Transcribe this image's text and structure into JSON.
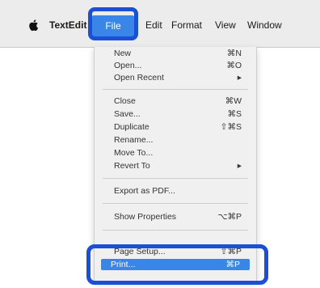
{
  "menubar": {
    "apple_icon": "apple-logo-icon",
    "app_name": "TextEdit",
    "items": [
      "File",
      "Edit",
      "Format",
      "View",
      "Window"
    ]
  },
  "file_menu": {
    "items": [
      {
        "label": "New",
        "shortcut": "⌘N"
      },
      {
        "label": "Open...",
        "shortcut": "⌘O"
      },
      {
        "label": "Open Recent",
        "shortcut": "▸"
      },
      {
        "label": "Close",
        "shortcut": "⌘W"
      },
      {
        "label": "Save...",
        "shortcut": "⌘S"
      },
      {
        "label": "Duplicate",
        "shortcut": "⇧⌘S"
      },
      {
        "label": "Rename...",
        "shortcut": ""
      },
      {
        "label": "Move To...",
        "shortcut": ""
      },
      {
        "label": "Revert To",
        "shortcut": "▸"
      },
      {
        "label": "Export as PDF...",
        "shortcut": ""
      },
      {
        "label": "Show Properties",
        "shortcut": "⌥⌘P"
      },
      {
        "label": "Page Setup...",
        "shortcut": "⇧⌘P"
      },
      {
        "label": "Print...",
        "shortcut": "⌘P"
      }
    ]
  },
  "colors": {
    "highlight_box": "#1b4fd6",
    "menu_selection": "#3a86e8"
  }
}
